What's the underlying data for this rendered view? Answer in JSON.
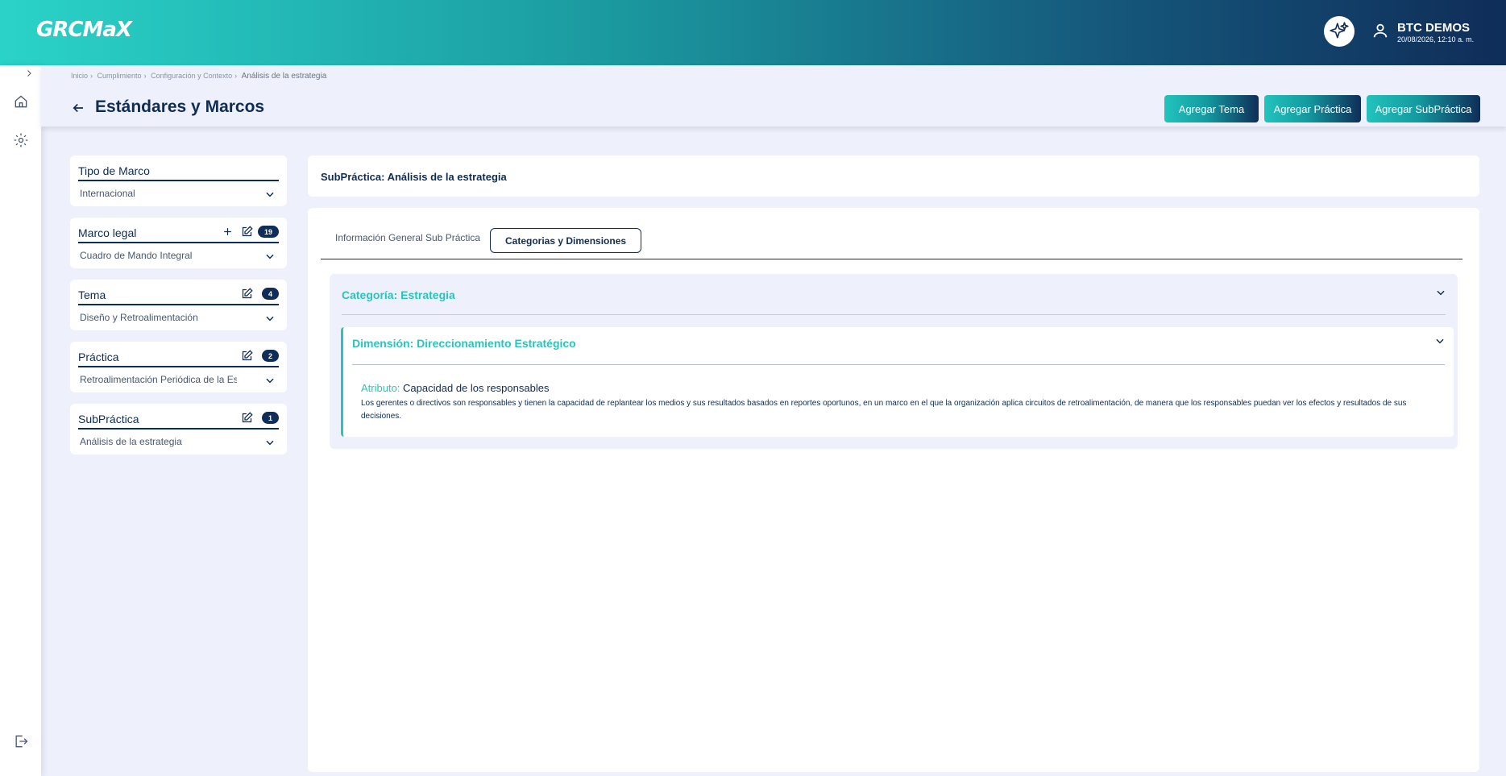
{
  "header": {
    "logo": "GRCMaX",
    "user_name": "BTC DEMOS",
    "user_date": "20/08/2026, 12:10 a. m."
  },
  "breadcrumb": [
    "Inicio",
    "Cumplimiento",
    "Configuración y Contexto",
    "Análisis de la estrategia"
  ],
  "page": {
    "title": "Estándares y Marcos"
  },
  "actions": {
    "add_tema": "Agregar Tema",
    "add_practica": "Agregar Práctica",
    "add_subpractica": "Agregar SubPráctica"
  },
  "filters": {
    "tipo_marco": {
      "label": "Tipo de Marco",
      "value": "Internacional"
    },
    "marco_legal": {
      "label": "Marco legal",
      "value": "Cuadro de Mando Integral",
      "count": "19"
    },
    "tema": {
      "label": "Tema",
      "value": "Diseño y Retroalimentación",
      "count": "4"
    },
    "practica": {
      "label": "Práctica",
      "value": "Retroalimentación Periódica de la Estrategia",
      "count": "2"
    },
    "subpractica": {
      "label": "SubPráctica",
      "value": "Análisis de la estrategia",
      "count": "1"
    }
  },
  "detail": {
    "title": "SubPráctica: Análisis de la estrategia",
    "tabs": [
      "Información General Sub Práctica",
      "Categorias y Dimensiones"
    ],
    "category": "Categoría: Estrategia",
    "dimension": "Dimensión: Direccionamiento Estratégico",
    "attribute_key": "Atributo:",
    "attribute_value": "Capacidad de los responsables",
    "description": "Los gerentes o directivos son responsables y tienen la capacidad de replantear los medios y sus resultados basados en reportes oportunos, en un marco en el que la organización aplica circuitos de retroalimentación, de manera que los responsables puedan ver los efectos y resultados de sus decisiones."
  },
  "colors": {
    "accent": "#2bc4bd",
    "navy": "#0f2d52"
  }
}
